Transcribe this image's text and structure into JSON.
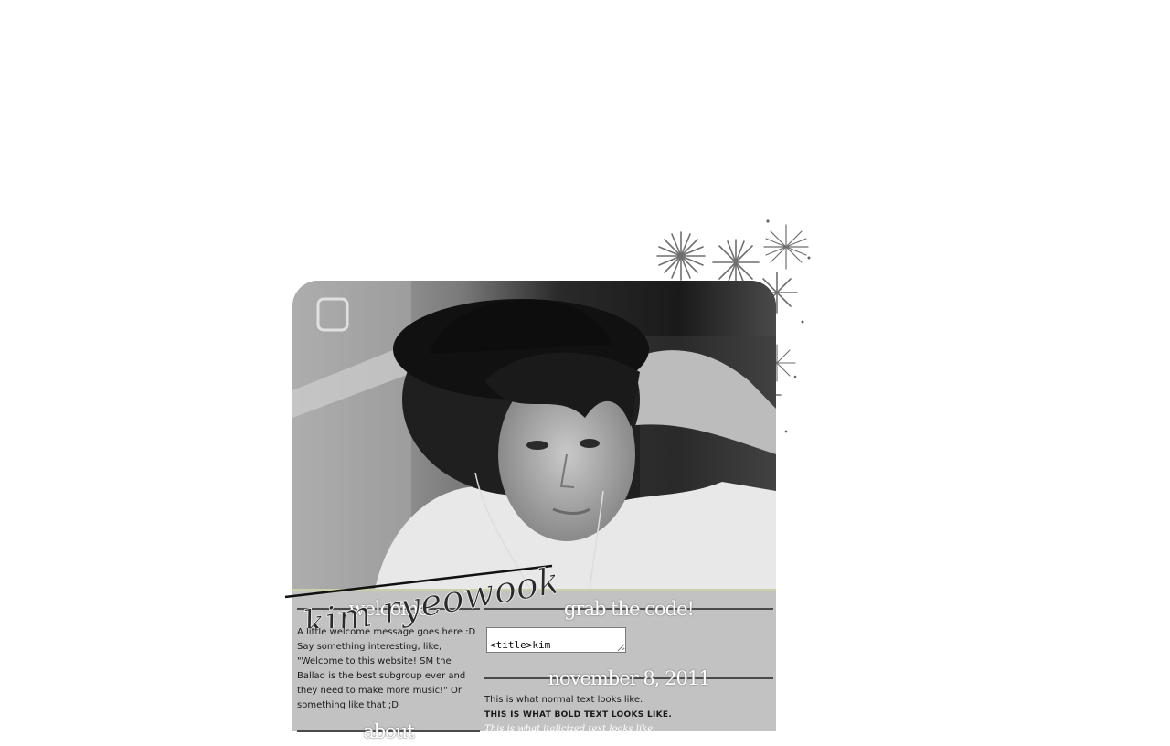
{
  "site": {
    "signature_text": "kim ryeowook"
  },
  "left_column": {
    "welcome_heading": "welcome",
    "welcome_text": "A little welcome message goes here :D Say something interesting, like, \"Welcome to this website! SM the Ballad is the best subgroup ever and they need to make more music!\" Or something like that ;D",
    "about_heading": "about"
  },
  "right_column": {
    "code_heading": "grab the code!",
    "code_value": "<title>kim",
    "date_heading": "november 8, 2011",
    "normal_text": "This is what normal text looks like.",
    "bold_text": "This is what bold text looks like.",
    "italic_text": "This is what italicized text looks like."
  },
  "colors": {
    "panel": "#c2c2c2",
    "accent_rule": "#c7d3a6",
    "heading_text": "#ffffff"
  },
  "icons": {
    "flower_decoration": "flower-cluster-icon"
  }
}
